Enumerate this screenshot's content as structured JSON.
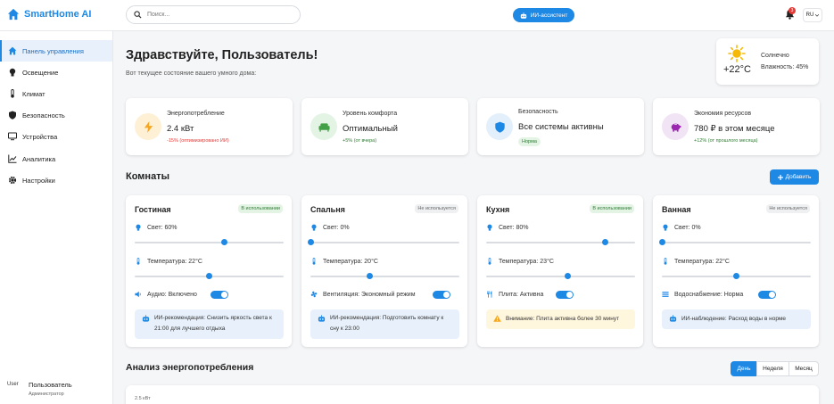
{
  "app": {
    "name": "SmartHome AI"
  },
  "search": {
    "placeholder": "Поиск..."
  },
  "header": {
    "ai_button": "ИИ-ассистент",
    "notifications_count": "3",
    "language": "RU"
  },
  "sidebar": {
    "items": [
      {
        "label": "Панель управления",
        "icon": "home-icon",
        "active": true
      },
      {
        "label": "Освещение",
        "icon": "bulb-icon"
      },
      {
        "label": "Климат",
        "icon": "thermometer-icon"
      },
      {
        "label": "Безопасность",
        "icon": "shield-icon"
      },
      {
        "label": "Устройства",
        "icon": "monitor-icon"
      },
      {
        "label": "Аналитика",
        "icon": "chart-line-icon"
      },
      {
        "label": "Настройки",
        "icon": "gear-icon"
      }
    ],
    "user": {
      "avatar_alt": "User",
      "name": "Пользователь",
      "role": "Администратор"
    }
  },
  "main": {
    "greeting": "Здравствуйте, Пользователь!",
    "subtitle": "Вот текущее состояние вашего умного дома:",
    "weather": {
      "temperature": "+22°C",
      "condition": "Солнечно",
      "humidity": "Влажность: 45%",
      "icon": "sun-icon"
    },
    "stats": [
      {
        "label": "Энергопотребление",
        "value": "2.4 кВт",
        "note": "-15% (оптимизировано ИИ)",
        "note_color": "#e53935",
        "icon": "bolt-icon",
        "icon_bg": "#fdf0d5",
        "icon_color": "#f5a623"
      },
      {
        "label": "Уровень комфорта",
        "value": "Оптимальный",
        "note": "+5% (от вчера)",
        "note_color": "#2e7d32",
        "icon": "sofa-icon",
        "icon_bg": "#e3f4e5",
        "icon_color": "#43a047"
      },
      {
        "label": "Безопасность",
        "value": "Все системы активны",
        "pill": "Норма",
        "icon": "shield-icon",
        "icon_bg": "#e3effb",
        "icon_color": "#1e88e5"
      },
      {
        "label": "Экономия ресурсов",
        "value": "780 ₽ в этом месяце",
        "note": "+12% (от прошлого месяца)",
        "note_color": "#2e7d32",
        "icon": "piggy-bank-icon",
        "icon_bg": "#f1e4f5",
        "icon_color": "#9c27b0"
      }
    ],
    "rooms_title": "Комнаты",
    "add_button": "Добавить",
    "rooms": [
      {
        "name": "Гостиная",
        "status": "В использовании",
        "in_use": true,
        "light_label": "Свет: 60%",
        "light_level": 0.6,
        "temp_label": "Температура: 22°C",
        "temp_level": 0.5,
        "device_label": "Аудио: Включено",
        "device_icon": "speaker-icon",
        "rec": "ИИ-рекомендация: Снизить яркость света к 21:00 для лучшего отдыха",
        "rec_type": "info"
      },
      {
        "name": "Спальня",
        "status": "Не используется",
        "in_use": false,
        "light_label": "Свет: 0%",
        "light_level": 0.0,
        "temp_label": "Температура: 20°C",
        "temp_level": 0.4,
        "device_label": "Вентиляция: Экономный режим",
        "device_icon": "fan-icon",
        "rec": "ИИ-рекомендация: Подготовить комнату к сну к 23:00",
        "rec_type": "info"
      },
      {
        "name": "Кухня",
        "status": "В использовании",
        "in_use": true,
        "light_label": "Свет: 80%",
        "light_level": 0.8,
        "temp_label": "Температура: 23°C",
        "temp_level": 0.55,
        "device_label": "Плита: Активна",
        "device_icon": "utensils-icon",
        "rec": "Внимание: Плита активна более 30 минут",
        "rec_type": "warning"
      },
      {
        "name": "Ванная",
        "status": "Не используется",
        "in_use": false,
        "light_label": "Свет: 0%",
        "light_level": 0.0,
        "temp_label": "Температура: 22°C",
        "temp_level": 0.5,
        "device_label": "Водоснабжение: Норма",
        "device_icon": "water-icon",
        "rec": "ИИ-наблюдение: Расход воды в норме",
        "rec_type": "info"
      }
    ],
    "analysis": {
      "title": "Анализ энергопотребления",
      "tabs": [
        {
          "label": "День",
          "active": true
        },
        {
          "label": "Неделя"
        },
        {
          "label": "Месяц"
        }
      ],
      "chart_data": {
        "type": "line",
        "title": "",
        "xlabel": "",
        "ylabel": "",
        "y_tick_top": "2.5 кВт"
      }
    }
  }
}
